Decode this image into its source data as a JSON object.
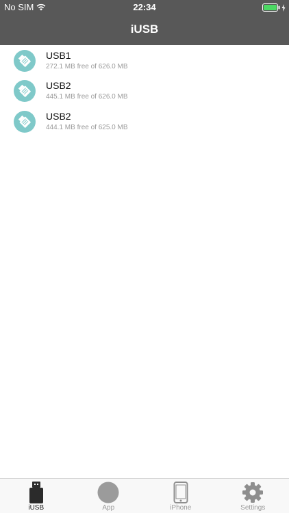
{
  "status_bar": {
    "carrier": "No SIM",
    "time": "22:34",
    "battery_color": "#4cd964"
  },
  "nav": {
    "title": "iUSB"
  },
  "drives": [
    {
      "name": "USB1",
      "free": "272.1 MB free of 626.0 MB"
    },
    {
      "name": "USB2",
      "free": "445.1 MB free of 626.0 MB"
    },
    {
      "name": "USB2",
      "free": "444.1 MB free of 625.0 MB"
    }
  ],
  "drive_icon_color": "#7fc9c9",
  "tabs": [
    {
      "label": "iUSB",
      "icon": "usb-stick-icon",
      "active": true
    },
    {
      "label": "App",
      "icon": "app-circle-icon",
      "active": false
    },
    {
      "label": "iPhone",
      "icon": "iphone-icon",
      "active": false
    },
    {
      "label": "Settings",
      "icon": "gear-icon",
      "active": false
    }
  ]
}
